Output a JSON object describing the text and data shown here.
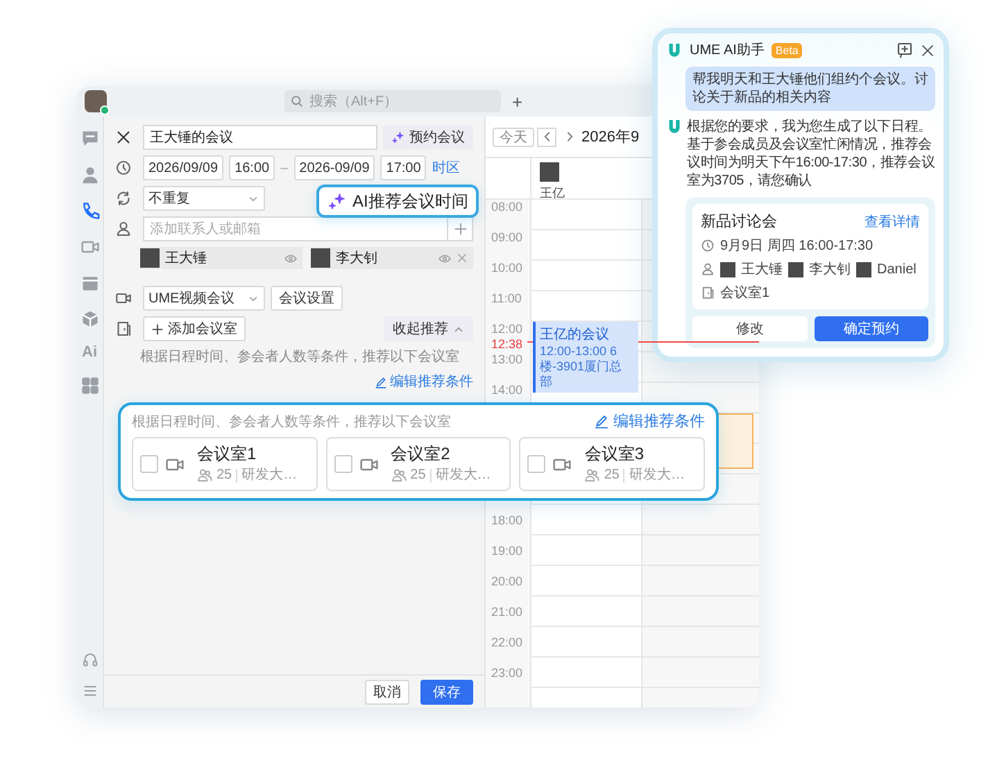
{
  "top_bar": {
    "search": {
      "placeholder": "搜索（Alt+F）"
    },
    "add": "+"
  },
  "sidebar": {
    "items": [
      {
        "kind": "chat",
        "selected": false
      },
      {
        "kind": "contacts",
        "selected": false
      },
      {
        "kind": "phone",
        "selected": true
      },
      {
        "kind": "video",
        "selected": false
      },
      {
        "kind": "calendar",
        "selected": false
      },
      {
        "kind": "cube",
        "selected": false
      },
      {
        "kind": "ai",
        "label": "Ai",
        "selected": false
      },
      {
        "kind": "apps",
        "selected": false
      }
    ]
  },
  "form": {
    "title": "王大锤的会议",
    "book_button": "预约会议",
    "start_date": "2026/09/09",
    "start_time": "16:00",
    "dash": "–",
    "end_date": "2026-09/09",
    "end_time": "17:00",
    "timezone_link": "时区",
    "repeat": "不重复",
    "attendee_field": {
      "placeholder": "添加联系人或邮箱"
    },
    "attendees": [
      {
        "name": "王大锤",
        "removable": false
      },
      {
        "name": "李大钊",
        "removable": true
      }
    ],
    "meeting_type": "UME视频会议",
    "meeting_settings": "会议设置",
    "add_room": "添加会议室",
    "collapse": "收起推荐",
    "room_hint": "根据日程时间、参会者人数等条件，推荐以下会议室",
    "edit_conditions": "编辑推荐条件",
    "cancel": "取消",
    "save": "保存"
  },
  "calendar": {
    "today": "今天",
    "month": "2026年9",
    "people": [
      {
        "name": "王亿"
      }
    ],
    "hours_top": [
      "08:00",
      "09:00",
      "10:00",
      "11:00",
      "12:00",
      "13:00",
      "14:00"
    ],
    "hours_bottom": [
      "18:00",
      "19:00",
      "20:00",
      "21:00",
      "22:00",
      "23:00"
    ],
    "now": "12:38",
    "event": {
      "title": "王亿的会议",
      "detail": "12:00-13:00 6楼-3901厦门总部"
    }
  },
  "callout": {
    "label": "AI推荐会议时间"
  },
  "room_panel": {
    "hint": "根据日程时间、参会者人数等条件，推荐以下会议室",
    "edit_link": "编辑推荐条件",
    "rooms": [
      {
        "name": "会议室1",
        "capacity": "25",
        "building": "研发大…",
        "checked": false
      },
      {
        "name": "会议室2",
        "capacity": "25",
        "building": "研发大…",
        "checked": false
      },
      {
        "name": "会议室3",
        "capacity": "25",
        "building": "研发大…",
        "checked": false
      }
    ]
  },
  "assistant": {
    "title": "UME AI助手",
    "badge": "Beta",
    "user_message": "帮我明天和王大锤他们组约个会议。讨论关于新品的相关内容",
    "reply_lines": [
      "根据您的要求，我为您生成了以下日程。",
      "基于参会成员及会议室忙闲情况，推荐会议时间为明天下午16:00-17:30，推荐会议室为3705，请您确认"
    ],
    "card": {
      "title": "新品讨论会",
      "details_link": "查看详情",
      "time": "9月9日 周四 16:00-17:30",
      "attendees": [
        "王大锤",
        "李大钊",
        "Daniel"
      ],
      "room": "会议室1",
      "modify": "修改",
      "confirm": "确定预约"
    }
  }
}
